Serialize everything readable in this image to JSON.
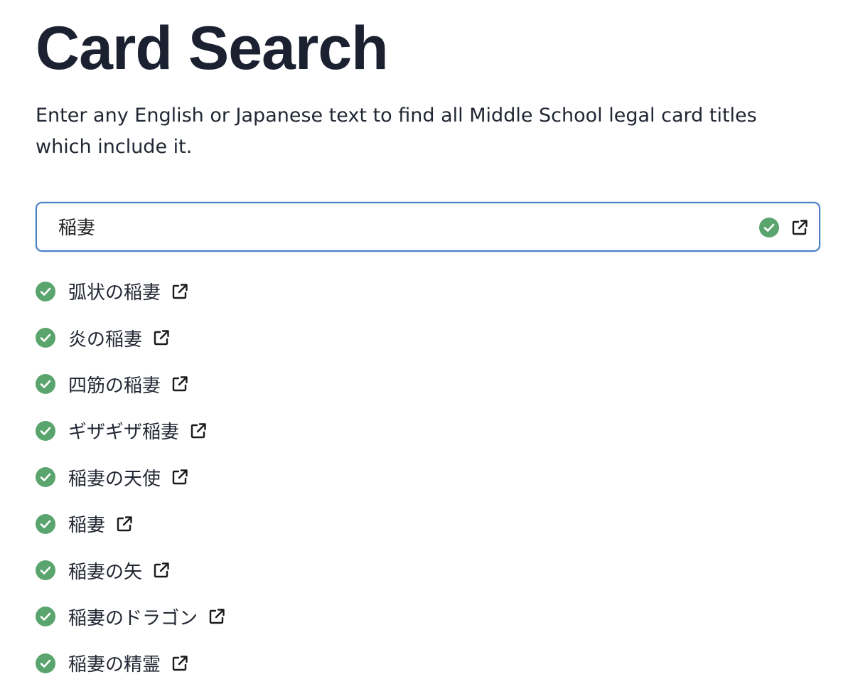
{
  "header": {
    "title": "Card Search",
    "description": "Enter any English or Japanese text to find all Middle School legal card titles which include it."
  },
  "search": {
    "value": "稲妻",
    "placeholder": ""
  },
  "results": [
    {
      "name": "弧状の稲妻"
    },
    {
      "name": "炎の稲妻"
    },
    {
      "name": "四筋の稲妻"
    },
    {
      "name": "ギザギザ稲妻"
    },
    {
      "name": "稲妻の天使"
    },
    {
      "name": "稲妻"
    },
    {
      "name": "稲妻の矢"
    },
    {
      "name": "稲妻のドラゴン"
    },
    {
      "name": "稲妻の精霊"
    }
  ],
  "icons": {
    "valid": "check-circle-icon",
    "link": "external-link-icon"
  },
  "colors": {
    "check": "#5aa46d",
    "focus_border": "#4a80c4",
    "title": "#1b2130"
  }
}
